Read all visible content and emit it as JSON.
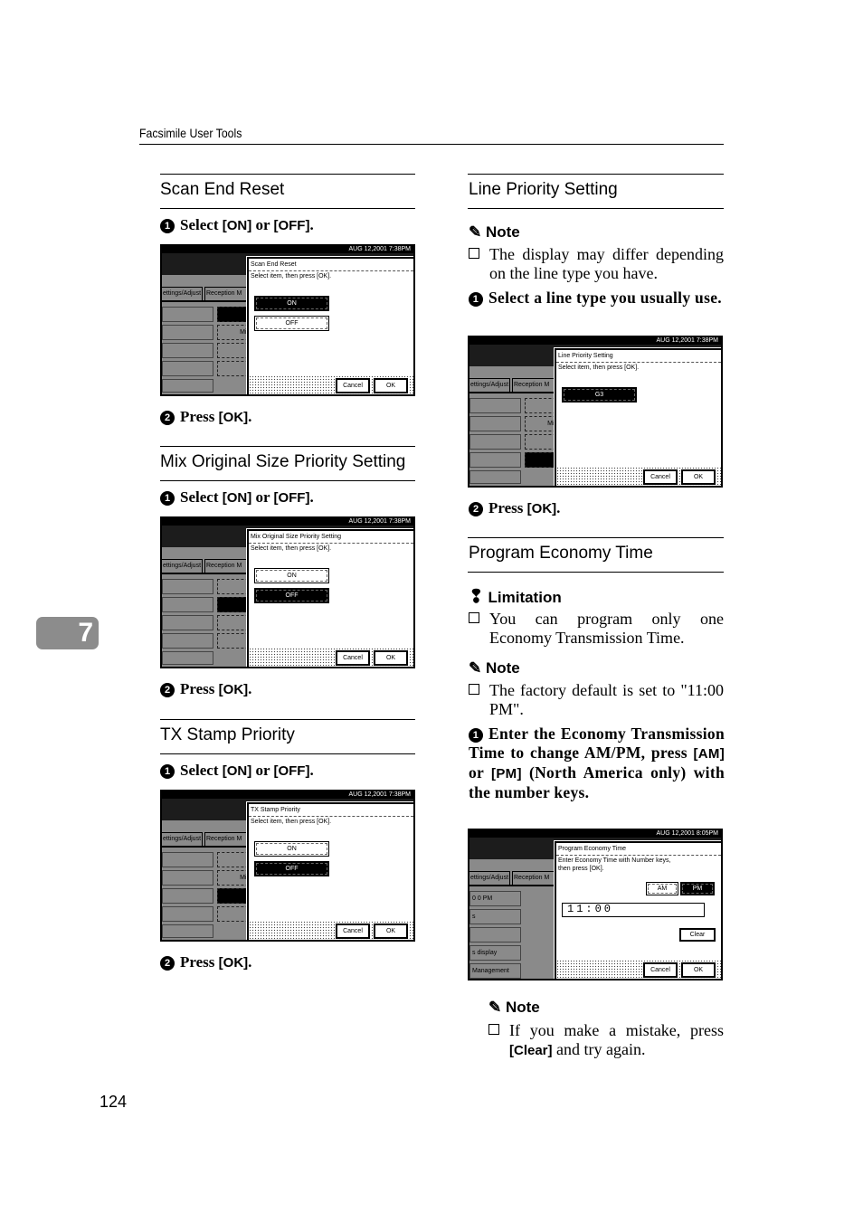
{
  "header": {
    "running_title": "Facsimile User Tools",
    "chapter": "7",
    "page_number": "124"
  },
  "icons": {
    "note": "pencil-icon",
    "limitation": "exclamation-icon",
    "bullet": "checkbox-square-icon"
  },
  "left": {
    "scan_end_reset": {
      "title": "Scan End Reset",
      "step1": {
        "num": "1",
        "pre": "Select ",
        "k1": "[ON]",
        "mid": " or ",
        "k2": "[OFF]",
        "post": "."
      },
      "step2": {
        "num": "2",
        "pre": "Press ",
        "k1": "[OK]",
        "post": "."
      }
    },
    "mix_original": {
      "title": "Mix Original Size Priority Setting",
      "step1": {
        "num": "1",
        "pre": "Select ",
        "k1": "[ON]",
        "mid": " or ",
        "k2": "[OFF]",
        "post": "."
      },
      "step2": {
        "num": "2",
        "pre": "Press ",
        "k1": "[OK]",
        "post": "."
      }
    },
    "tx_stamp": {
      "title": "TX Stamp Priority",
      "step1": {
        "num": "1",
        "pre": "Select ",
        "k1": "[ON]",
        "mid": " or ",
        "k2": "[OFF]",
        "post": "."
      },
      "step2": {
        "num": "2",
        "pre": "Press ",
        "k1": "[OK]",
        "post": "."
      }
    }
  },
  "right": {
    "line_priority": {
      "title": "Line Priority Setting",
      "note_label": "Note",
      "note_text": "The display may differ depending on the line type you have.",
      "step1": {
        "num": "1",
        "text": "Select a line type you usually use."
      },
      "step2": {
        "num": "2",
        "pre": "Press ",
        "k1": "[OK]",
        "post": "."
      }
    },
    "economy": {
      "title": "Program Economy Time",
      "limitation_label": "Limitation",
      "limitation_text": "You can program only one Economy Transmission Time.",
      "note_label": "Note",
      "note_text": "The factory default is set to \"11:00 PM\".",
      "step1": {
        "num": "1",
        "a": "Enter the Economy Transmission Time to change AM/PM, press ",
        "k1": "[AM]",
        "b": " or ",
        "k2": "[PM]",
        "c": " (North America only) with the number keys."
      },
      "note2_label": "Note",
      "note2_pre": "If you make a mistake, press ",
      "note2_key": "[Clear]",
      "note2_post": " and try again."
    }
  },
  "screens": {
    "scan_end": {
      "date": "AUG 12,2001 7:38PM",
      "tabs": [
        "ettings/Adjust",
        "Reception M"
      ],
      "left_rows": [
        "",
        "",
        "",
        "",
        ""
      ],
      "mid_boxes": [
        {
          "label": "",
          "dark": true
        },
        {
          "label": "Mix",
          "dark": false
        },
        {
          "label": "",
          "dark": false
        },
        {
          "label": "",
          "dark": false
        }
      ],
      "dialog": {
        "title": "Scan End Reset",
        "instruction": [
          "Select item, then press [OK]."
        ],
        "options": [
          {
            "label": "ON",
            "selected": true
          },
          {
            "label": "OFF",
            "selected": false
          }
        ]
      },
      "cancel": "Cancel",
      "ok": "OK"
    },
    "mix": {
      "date": "AUG 12,2001 7:38PM",
      "tabs": [
        "ettings/Adjust",
        "Reception M"
      ],
      "left_rows": [
        "",
        "",
        "",
        "",
        ""
      ],
      "mid_boxes": [
        {
          "label": "",
          "dark": false
        },
        {
          "label": "Mix",
          "dark": true
        },
        {
          "label": "",
          "dark": false
        },
        {
          "label": "",
          "dark": false
        }
      ],
      "dialog": {
        "title": "Mix Original Size Priority Setting",
        "instruction": [
          "Select item, then press [OK]."
        ],
        "options": [
          {
            "label": "ON",
            "selected": false
          },
          {
            "label": "OFF",
            "selected": true
          }
        ]
      },
      "cancel": "Cancel",
      "ok": "OK"
    },
    "tx": {
      "date": "AUG 12,2001 7:38PM",
      "tabs": [
        "ettings/Adjust",
        "Reception M"
      ],
      "left_rows": [
        "",
        "",
        "",
        "",
        ""
      ],
      "mid_boxes": [
        {
          "label": "",
          "dark": false
        },
        {
          "label": "Mix",
          "dark": false
        },
        {
          "label": "",
          "dark": true
        },
        {
          "label": "",
          "dark": false
        }
      ],
      "dialog": {
        "title": "TX Stamp Priority",
        "instruction": [
          "Select item, then press [OK]."
        ],
        "options": [
          {
            "label": "ON",
            "selected": false
          },
          {
            "label": "OFF",
            "selected": true
          }
        ]
      },
      "cancel": "Cancel",
      "ok": "OK"
    },
    "line": {
      "date": "AUG 12,2001 7:38PM",
      "tabs": [
        "ettings/Adjust",
        "Reception M"
      ],
      "left_rows": [
        "",
        "",
        "",
        "",
        ""
      ],
      "mid_boxes": [
        {
          "label": "",
          "dark": false
        },
        {
          "label": "Mix",
          "dark": false
        },
        {
          "label": "",
          "dark": false
        },
        {
          "label": "",
          "dark": true
        }
      ],
      "dialog": {
        "title": "Line Priority Setting",
        "instruction": [
          "Select item, then press [OK]."
        ],
        "options": [
          {
            "label": "G3",
            "selected": true
          }
        ]
      },
      "cancel": "Cancel",
      "ok": "OK"
    },
    "economy": {
      "date": "AUG 12,2001 8:05PM",
      "tabs": [
        "ettings/Adjust",
        "Reception M"
      ],
      "left_rows": [
        "0 0  PM",
        "s",
        "",
        "s display",
        "Management"
      ],
      "mid_boxes": [],
      "dialog": {
        "title": "Program Economy Time",
        "instruction": [
          "Enter Economy Time with Number keys,",
          "then press [OK]."
        ],
        "options": [],
        "am": "AM",
        "pm": "PM",
        "pm_selected": true,
        "field": "11:00",
        "clear": "Clear"
      },
      "cancel": "Cancel",
      "ok": "OK"
    }
  }
}
